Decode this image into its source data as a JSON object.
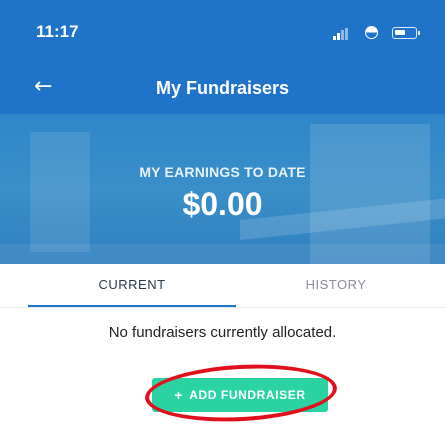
{
  "status_bar": {
    "time": "11:17",
    "icons": [
      "signal-icon",
      "wifi-icon",
      "battery-icon"
    ]
  },
  "nav": {
    "back_icon": "arrow-left-icon",
    "title": "My Fundraisers"
  },
  "earnings": {
    "label": "MY EARNINGS TO DATE",
    "amount": "$0.00"
  },
  "tabs": [
    {
      "label": "CURRENT",
      "selected": true
    },
    {
      "label": "HISTORY",
      "selected": false
    }
  ],
  "content": {
    "empty_message": "No fundraisers currently allocated."
  },
  "add_button": {
    "icon": "plus-icon",
    "label": "ADD FUNDRAISER"
  },
  "colors": {
    "primary": "#1f73c8",
    "button": "#2bd3a3",
    "annotation": "#e0101c"
  }
}
